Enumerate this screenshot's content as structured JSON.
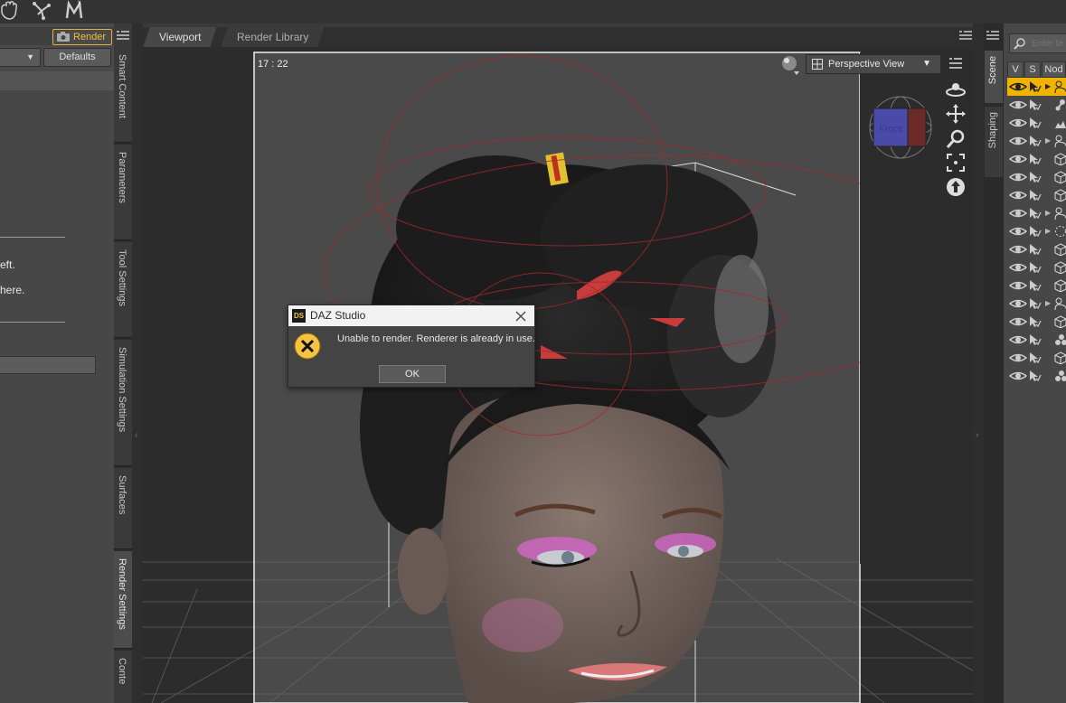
{
  "toolbar": {
    "icons": [
      "hand-pan-icon",
      "node-tool-icon",
      "m-logo-icon"
    ]
  },
  "left_panel": {
    "render_label": "Render",
    "defaults_label": "Defaults",
    "text_lines": [
      "eft.",
      " here."
    ]
  },
  "left_tabs": [
    {
      "label": "Smart Content",
      "active": false
    },
    {
      "label": "Parameters",
      "active": false
    },
    {
      "label": "Tool Settings",
      "active": false
    },
    {
      "label": "Simulation Settings",
      "active": false
    },
    {
      "label": "Surfaces",
      "active": false
    },
    {
      "label": "Render Settings",
      "active": true
    },
    {
      "label": "Conte",
      "active": false
    }
  ],
  "viewport": {
    "tabs": [
      {
        "label": "Viewport",
        "active": true
      },
      {
        "label": "Render Library",
        "active": false
      }
    ],
    "frame_time": "17 : 22",
    "view_mode": "Perspective View",
    "cube_face": "Front"
  },
  "dialog": {
    "title": "DAZ Studio",
    "logo_text": "DS",
    "message": "Unable to render. Renderer is already in use.",
    "ok_label": "OK"
  },
  "right_tabs": [
    {
      "label": "Scene",
      "active": true
    },
    {
      "label": "Shaping",
      "active": false
    }
  ],
  "scene": {
    "search_placeholder": "Enter te",
    "columns": [
      "V",
      "S",
      "Nod"
    ],
    "rows": [
      {
        "node_icon": "figure-icon",
        "expandable": true,
        "selected": true
      },
      {
        "node_icon": "bone-icon",
        "expandable": false,
        "selected": false
      },
      {
        "node_icon": "ground-icon",
        "expandable": false,
        "selected": false
      },
      {
        "node_icon": "figure-icon",
        "expandable": true,
        "selected": false
      },
      {
        "node_icon": "prop-cube-icon",
        "expandable": false,
        "selected": false
      },
      {
        "node_icon": "prop-cube-icon",
        "expandable": false,
        "selected": false
      },
      {
        "node_icon": "prop-cube-icon",
        "expandable": false,
        "selected": false
      },
      {
        "node_icon": "figure-icon",
        "expandable": true,
        "selected": false
      },
      {
        "node_icon": "group-dashed-icon",
        "expandable": true,
        "selected": false
      },
      {
        "node_icon": "prop-cube-icon",
        "expandable": false,
        "selected": false
      },
      {
        "node_icon": "prop-cube-icon",
        "expandable": false,
        "selected": false
      },
      {
        "node_icon": "prop-cube-icon",
        "expandable": false,
        "selected": false
      },
      {
        "node_icon": "figure-icon",
        "expandable": true,
        "selected": false
      },
      {
        "node_icon": "prop-cube-icon",
        "expandable": false,
        "selected": false
      },
      {
        "node_icon": "light-icon",
        "expandable": false,
        "selected": false
      },
      {
        "node_icon": "prop-cube-icon",
        "expandable": false,
        "selected": false
      },
      {
        "node_icon": "light-icon",
        "expandable": false,
        "selected": false
      }
    ]
  },
  "colors": {
    "accent": "#f0b400",
    "dialog_error": "#f5c242"
  }
}
